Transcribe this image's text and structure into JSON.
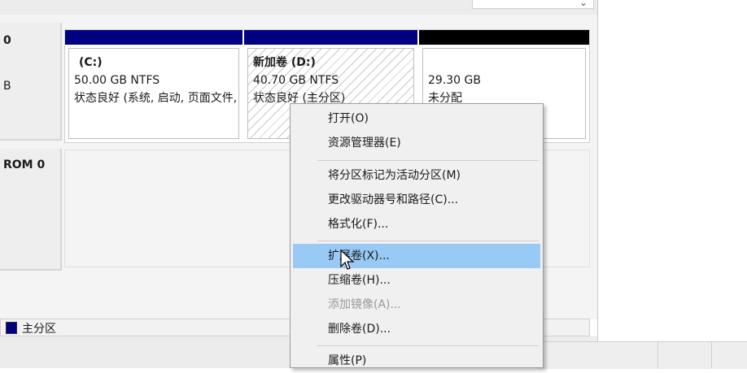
{
  "disks": [
    {
      "label": "0",
      "sub": "B",
      "partitions": [
        {
          "bar_color": "#000080",
          "name": "(C:)",
          "size": "50.00 GB NTFS",
          "status": "状态良好 (系统, 启动, 页面文件, 活动, 故障转储, 主分区)"
        },
        {
          "bar_color": "#000080",
          "name": "新加卷  (D:)",
          "size": "40.70 GB NTFS",
          "status": "状态良好 (主分区)",
          "selected": true
        },
        {
          "bar_color": "#000000",
          "name": "",
          "size": "29.30 GB",
          "status": "未分配"
        }
      ]
    },
    {
      "label": "ROM 0"
    }
  ],
  "legend": {
    "primary_label": "主分区",
    "primary_color": "#000080"
  },
  "context_menu": {
    "items": [
      {
        "label": "打开(O)"
      },
      {
        "label": "资源管理器(E)"
      },
      {
        "label": "将分区标记为活动分区(M)"
      },
      {
        "label": "更改驱动器号和路径(C)..."
      },
      {
        "label": "格式化(F)..."
      },
      {
        "label": "扩展卷(X)...",
        "highlighted": true
      },
      {
        "label": "压缩卷(H)..."
      },
      {
        "label": "添加镜像(A)...",
        "disabled": true
      },
      {
        "label": "删除卷(D)..."
      },
      {
        "label": "属性(P)"
      }
    ]
  },
  "colors": {
    "highlight": "#99c9f5"
  }
}
